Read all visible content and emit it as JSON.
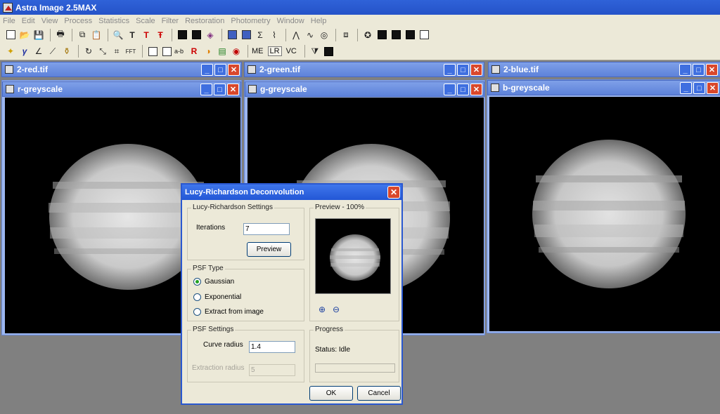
{
  "app": {
    "title": "Astra Image 2.5MAX"
  },
  "menu": [
    "File",
    "Edit",
    "View",
    "Process",
    "Statistics",
    "Scale",
    "Filter",
    "Restoration",
    "Photometry",
    "Window",
    "Help"
  ],
  "toolbar2_text": {
    "ab": "a-b",
    "me": "ME",
    "lr": "LR",
    "vc": "VC"
  },
  "windows": {
    "red": {
      "title": "2-red.tif"
    },
    "green": {
      "title": "2-green.tif"
    },
    "blue": {
      "title": "2-blue.tif"
    },
    "r_grey": {
      "title": "r-greyscale"
    },
    "g_grey": {
      "title": "g-greyscale"
    },
    "b_grey": {
      "title": "b-greyscale"
    }
  },
  "dialog": {
    "title": "Lucy-Richardson Deconvolution",
    "settings_group": "Lucy-Richardson Settings",
    "iterations_label": "Iterations",
    "iterations_value": "7",
    "preview_button": "Preview",
    "psf_type_group": "PSF Type",
    "psf_options": [
      "Gaussian",
      "Exponential",
      "Extract from image"
    ],
    "psf_selected": "Gaussian",
    "psf_settings_group": "PSF Settings",
    "curve_radius_label": "Curve radius",
    "curve_radius_value": "1.4",
    "extraction_radius_label": "Extraction radius",
    "extraction_radius_value": "5",
    "preview_group": "Preview - 100%",
    "progress_group": "Progress",
    "status": "Status: Idle",
    "ok_button": "OK",
    "cancel_button": "Cancel"
  }
}
